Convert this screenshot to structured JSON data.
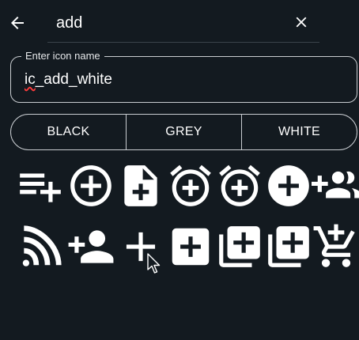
{
  "search": {
    "query": "add"
  },
  "icon_name_field": {
    "label": "Enter icon name",
    "value_prefix": "ic",
    "value_rest": "_add_white"
  },
  "color_toggle": {
    "options": [
      "BLACK",
      "GREY",
      "WHITE"
    ]
  },
  "icons": [
    "playlist-add-icon",
    "add-circle-outline-icon",
    "note-add-icon",
    "add-alarm-icon",
    "alarm-add-icon",
    "add-circle-icon",
    "group-add-icon",
    "wifi-add-icon",
    "person-add-icon",
    "add-icon",
    "add-box-icon",
    "library-add-icon",
    "library-add-icon",
    "add-shopping-cart-icon"
  ],
  "colors": {
    "background": "#131a20",
    "foreground": "#ffffff",
    "outline": "#c9cdd1"
  }
}
